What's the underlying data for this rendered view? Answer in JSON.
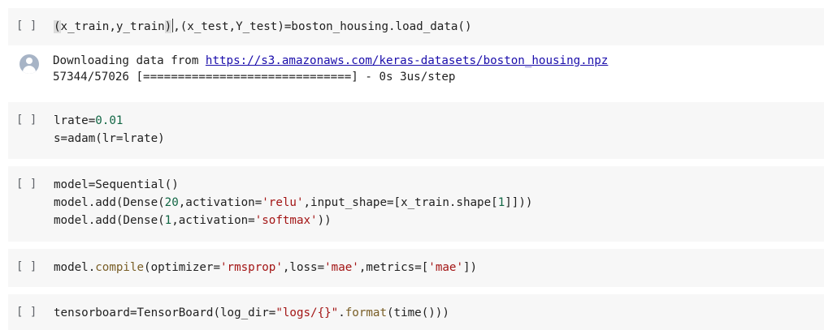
{
  "cells": [
    {
      "run_label": "[ ]",
      "code": {
        "open_paren": "(",
        "mid": "x_train,y_train",
        "close_paren": ")",
        "rest": ",(x_test,Y_test)=boston_housing.load_data()"
      }
    },
    {
      "run_label": "[ ]",
      "line1": {
        "a": "lrate=",
        "num": "0.01"
      },
      "line2": {
        "a": "s=adam(lr=lrate)"
      }
    },
    {
      "run_label": "[ ]",
      "line1": {
        "a": "model=Sequential()"
      },
      "line2": {
        "a": "model.add(Dense(",
        "num1": "20",
        "b": ",activation=",
        "str1": "'relu'",
        "c": ",input_shape=[x_train.shape[",
        "num2": "1",
        "d": "]]))"
      },
      "line3": {
        "a": "model.add(Dense(",
        "num1": "1",
        "b": ",activation=",
        "str1": "'softmax'",
        "c": "))"
      }
    },
    {
      "run_label": "[ ]",
      "line1": {
        "a": "model.",
        "fn": "compile",
        "b": "(optimizer=",
        "s1": "'rmsprop'",
        "c": ",loss=",
        "s2": "'mae'",
        "d": ",metrics=[",
        "s3": "'mae'",
        "e": "])"
      }
    },
    {
      "run_label": "[ ]",
      "line1": {
        "a": "tensorboard=TensorBoard(log_dir=",
        "s1": "\"logs/{}\"",
        "b": ".",
        "fn": "format",
        "c": "(time()))"
      }
    }
  ],
  "output": {
    "icon": "user-avatar-icon",
    "line1_prefix": "Downloading data from ",
    "line1_link": "https://s3.amazonaws.com/keras-datasets/boston_housing.npz",
    "line2": "57344/57026 [==============================] - 0s 3us/step"
  }
}
